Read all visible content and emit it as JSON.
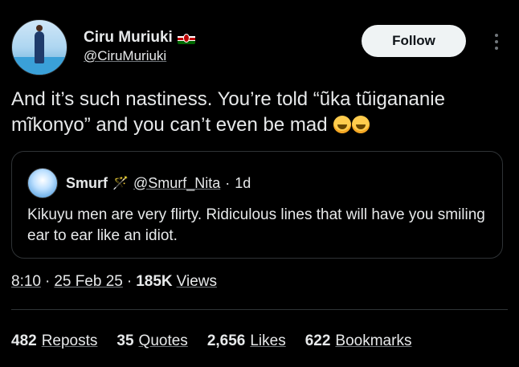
{
  "author": {
    "name": "Ciru Muriuki",
    "handle": "@CiruMuriuki",
    "flag_icon": "kenya-flag-icon"
  },
  "follow_label": "Follow",
  "tweet": {
    "text": "And it’s such nastiness. You’re told “ũka tũigananie mĩkonyo” and you can’t even be mad",
    "emoji": [
      "rolling-on-floor-laughing",
      "rolling-on-floor-laughing"
    ]
  },
  "quote": {
    "name": "Smurf",
    "badge": "🪄",
    "handle": "@Smurf_Nita",
    "dot": "·",
    "time": "1d",
    "text": "Kikuyu men are very flirty. Ridiculous lines that will have you smiling ear to ear like an idiot."
  },
  "meta": {
    "time": "8:10",
    "sep": "·",
    "date": "25 Feb 25",
    "views_count": "185K",
    "views_label": "Views"
  },
  "stats": [
    {
      "count": "482",
      "label": "Reposts"
    },
    {
      "count": "35",
      "label": "Quotes"
    },
    {
      "count": "2,656",
      "label": "Likes"
    },
    {
      "count": "622",
      "label": "Bookmarks"
    }
  ],
  "colors": {
    "background": "#000000",
    "text": "#e7e9ea",
    "muted": "#71767b",
    "border": "#2f3336",
    "follow_bg": "#eff3f4"
  }
}
